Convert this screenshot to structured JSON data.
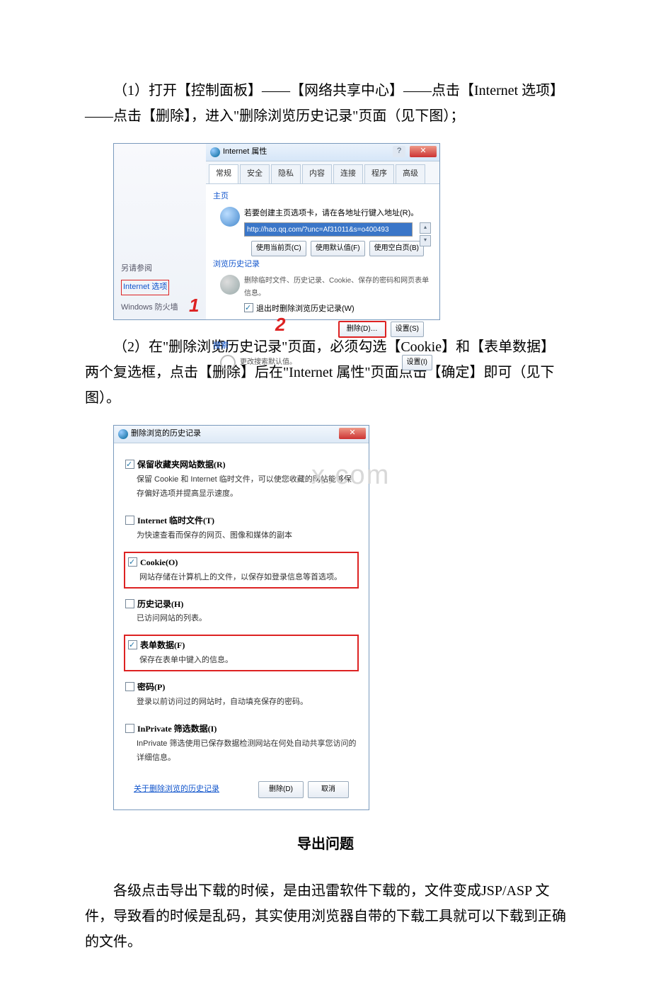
{
  "para1": "（1）打开【控制面板】——【网络共享中心】——点击【Internet 选项】——点击【删除】，进入\"删除浏览历史记录\"页面（见下图）；",
  "para2": "（2）在\"删除浏览历史记录\"页面，必须勾选【Cookie】和【表单数据】两个复选框，点击【删除】后在\"Internet 属性\"页面点击【确定】即可（见下图）。",
  "para3_title": "导出问题",
  "para3": "各级点击导出下载的时候，是由迅雷软件下载的，文件变成JSP/ASP 文件，导致看的时候是乱码，其实使用浏览器自带的下载工具就可以下载到正确的文件。",
  "dlg1": {
    "title": "Internet 属性",
    "tabs": [
      "常规",
      "安全",
      "隐私",
      "内容",
      "连接",
      "程序",
      "高级"
    ],
    "sec_home": "主页",
    "home_text": "若要创建主页选项卡，请在各地址行键入地址(R)。",
    "url": "http://hao.qq.com/?unc=Af31011&s=o400493",
    "btn_cur": "使用当前页(C)",
    "btn_def": "使用默认值(F)",
    "btn_blank": "使用空白页(B)",
    "sec_hist": "浏览历史记录",
    "hist_text": "删除临时文件、历史记录、Cookie、保存的密码和网页表单信息。",
    "hist_chk": "退出时删除浏览历史记录(W)",
    "btn_del": "删除(D)…",
    "btn_set": "设置(S)",
    "sec_search": "搜索",
    "search_text": "更改搜索默认值。",
    "btn_set2": "设置(I)",
    "side_ref": "另请参阅",
    "side_opt": "Internet 选项",
    "side_fw": "Windows 防火墙",
    "mark1": "1",
    "mark2": "2"
  },
  "dlg2": {
    "title": "删除浏览的历史记录",
    "opt1": {
      "t": "保留收藏夹网站数据(R)",
      "d": "保留 Cookie 和 Internet 临时文件，可以使您收藏的网站能够保存偏好选项并提高显示速度。"
    },
    "opt2": {
      "t": "Internet 临时文件(T)",
      "d": "为快速查看而保存的网页、图像和媒体的副本"
    },
    "opt3": {
      "t": "Cookie(O)",
      "d": "网站存储在计算机上的文件，以保存如登录信息等首选项。"
    },
    "opt4": {
      "t": "历史记录(H)",
      "d": "已访问网站的列表。"
    },
    "opt5": {
      "t": "表单数据(F)",
      "d": "保存在表单中键入的信息。"
    },
    "opt6": {
      "t": "密码(P)",
      "d": "登录以前访问过的网站时，自动填充保存的密码。"
    },
    "opt7": {
      "t": "InPrivate 筛选数据(I)",
      "d": "InPrivate 筛选使用已保存数据检测网站在何处自动共享您访问的详细信息。"
    },
    "link": "关于删除浏览的历史记录",
    "btn_del": "删除(D)",
    "btn_cancel": "取消"
  },
  "watermark": "x.com"
}
